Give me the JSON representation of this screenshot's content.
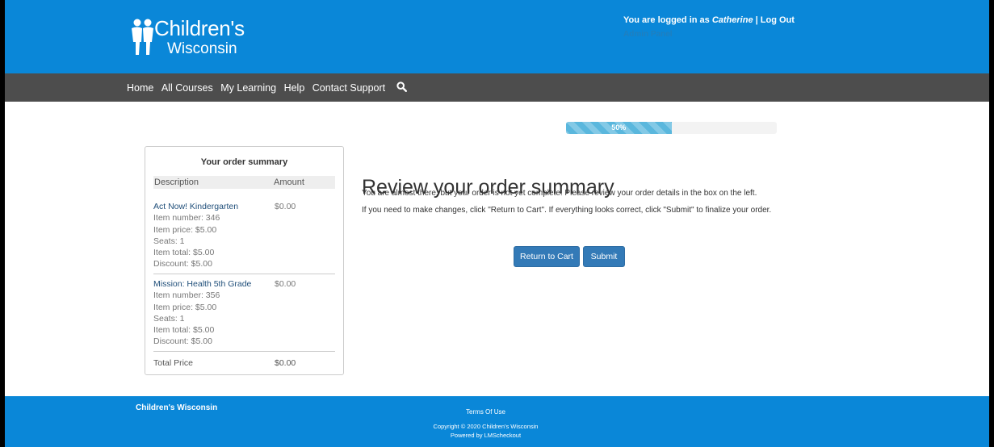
{
  "header": {
    "brand_line1": "Children's",
    "brand_line2": "Wisconsin",
    "logged_in_prefix": "You are logged in as ",
    "username": "Catherine",
    "separator": " | ",
    "logout_label": "Log Out",
    "admin_panel_label": "Admin Panel"
  },
  "nav": {
    "items": [
      "Home",
      "All Courses",
      "My Learning",
      "Help",
      "Contact Support"
    ],
    "search_icon": "search-icon"
  },
  "progress": {
    "label": "50%",
    "value_percent": 50
  },
  "summary": {
    "title": "Your order summary",
    "col_description": "Description",
    "col_amount": "Amount",
    "items": [
      {
        "name": "Act Now! Kindergarten",
        "amount": "$0.00",
        "details": [
          "Item number: 346",
          "Item price: $5.00",
          "Seats: 1",
          "Item total: $5.00",
          "Discount: $5.00"
        ]
      },
      {
        "name": "Mission: Health 5th Grade",
        "amount": "$0.00",
        "details": [
          "Item number: 356",
          "Item price: $5.00",
          "Seats: 1",
          "Item total: $5.00",
          "Discount: $5.00"
        ]
      }
    ],
    "total_label": "Total Price",
    "total_amount": "$0.00"
  },
  "main": {
    "title": "Review your order summary",
    "paragraph1": "You are almost there, but your order is not yet complete. Please review your order details in the box on the left.",
    "paragraph2": "If you need to make changes, click \"Return to Cart\". If everything looks correct, click \"Submit\" to finalize your order.",
    "return_label": "Return to Cart",
    "submit_label": "Submit"
  },
  "footer": {
    "org": "Children's Wisconsin",
    "terms": "Terms Of Use",
    "copyright": "Copyright © 2020 Children's Wisconsin",
    "powered": "Powered by LMScheckout"
  },
  "colors": {
    "brand_blue": "#0a87d8",
    "nav_gray": "#4d4d4d",
    "button_blue": "#337ab7",
    "progress_blue": "#5ab7dd"
  }
}
